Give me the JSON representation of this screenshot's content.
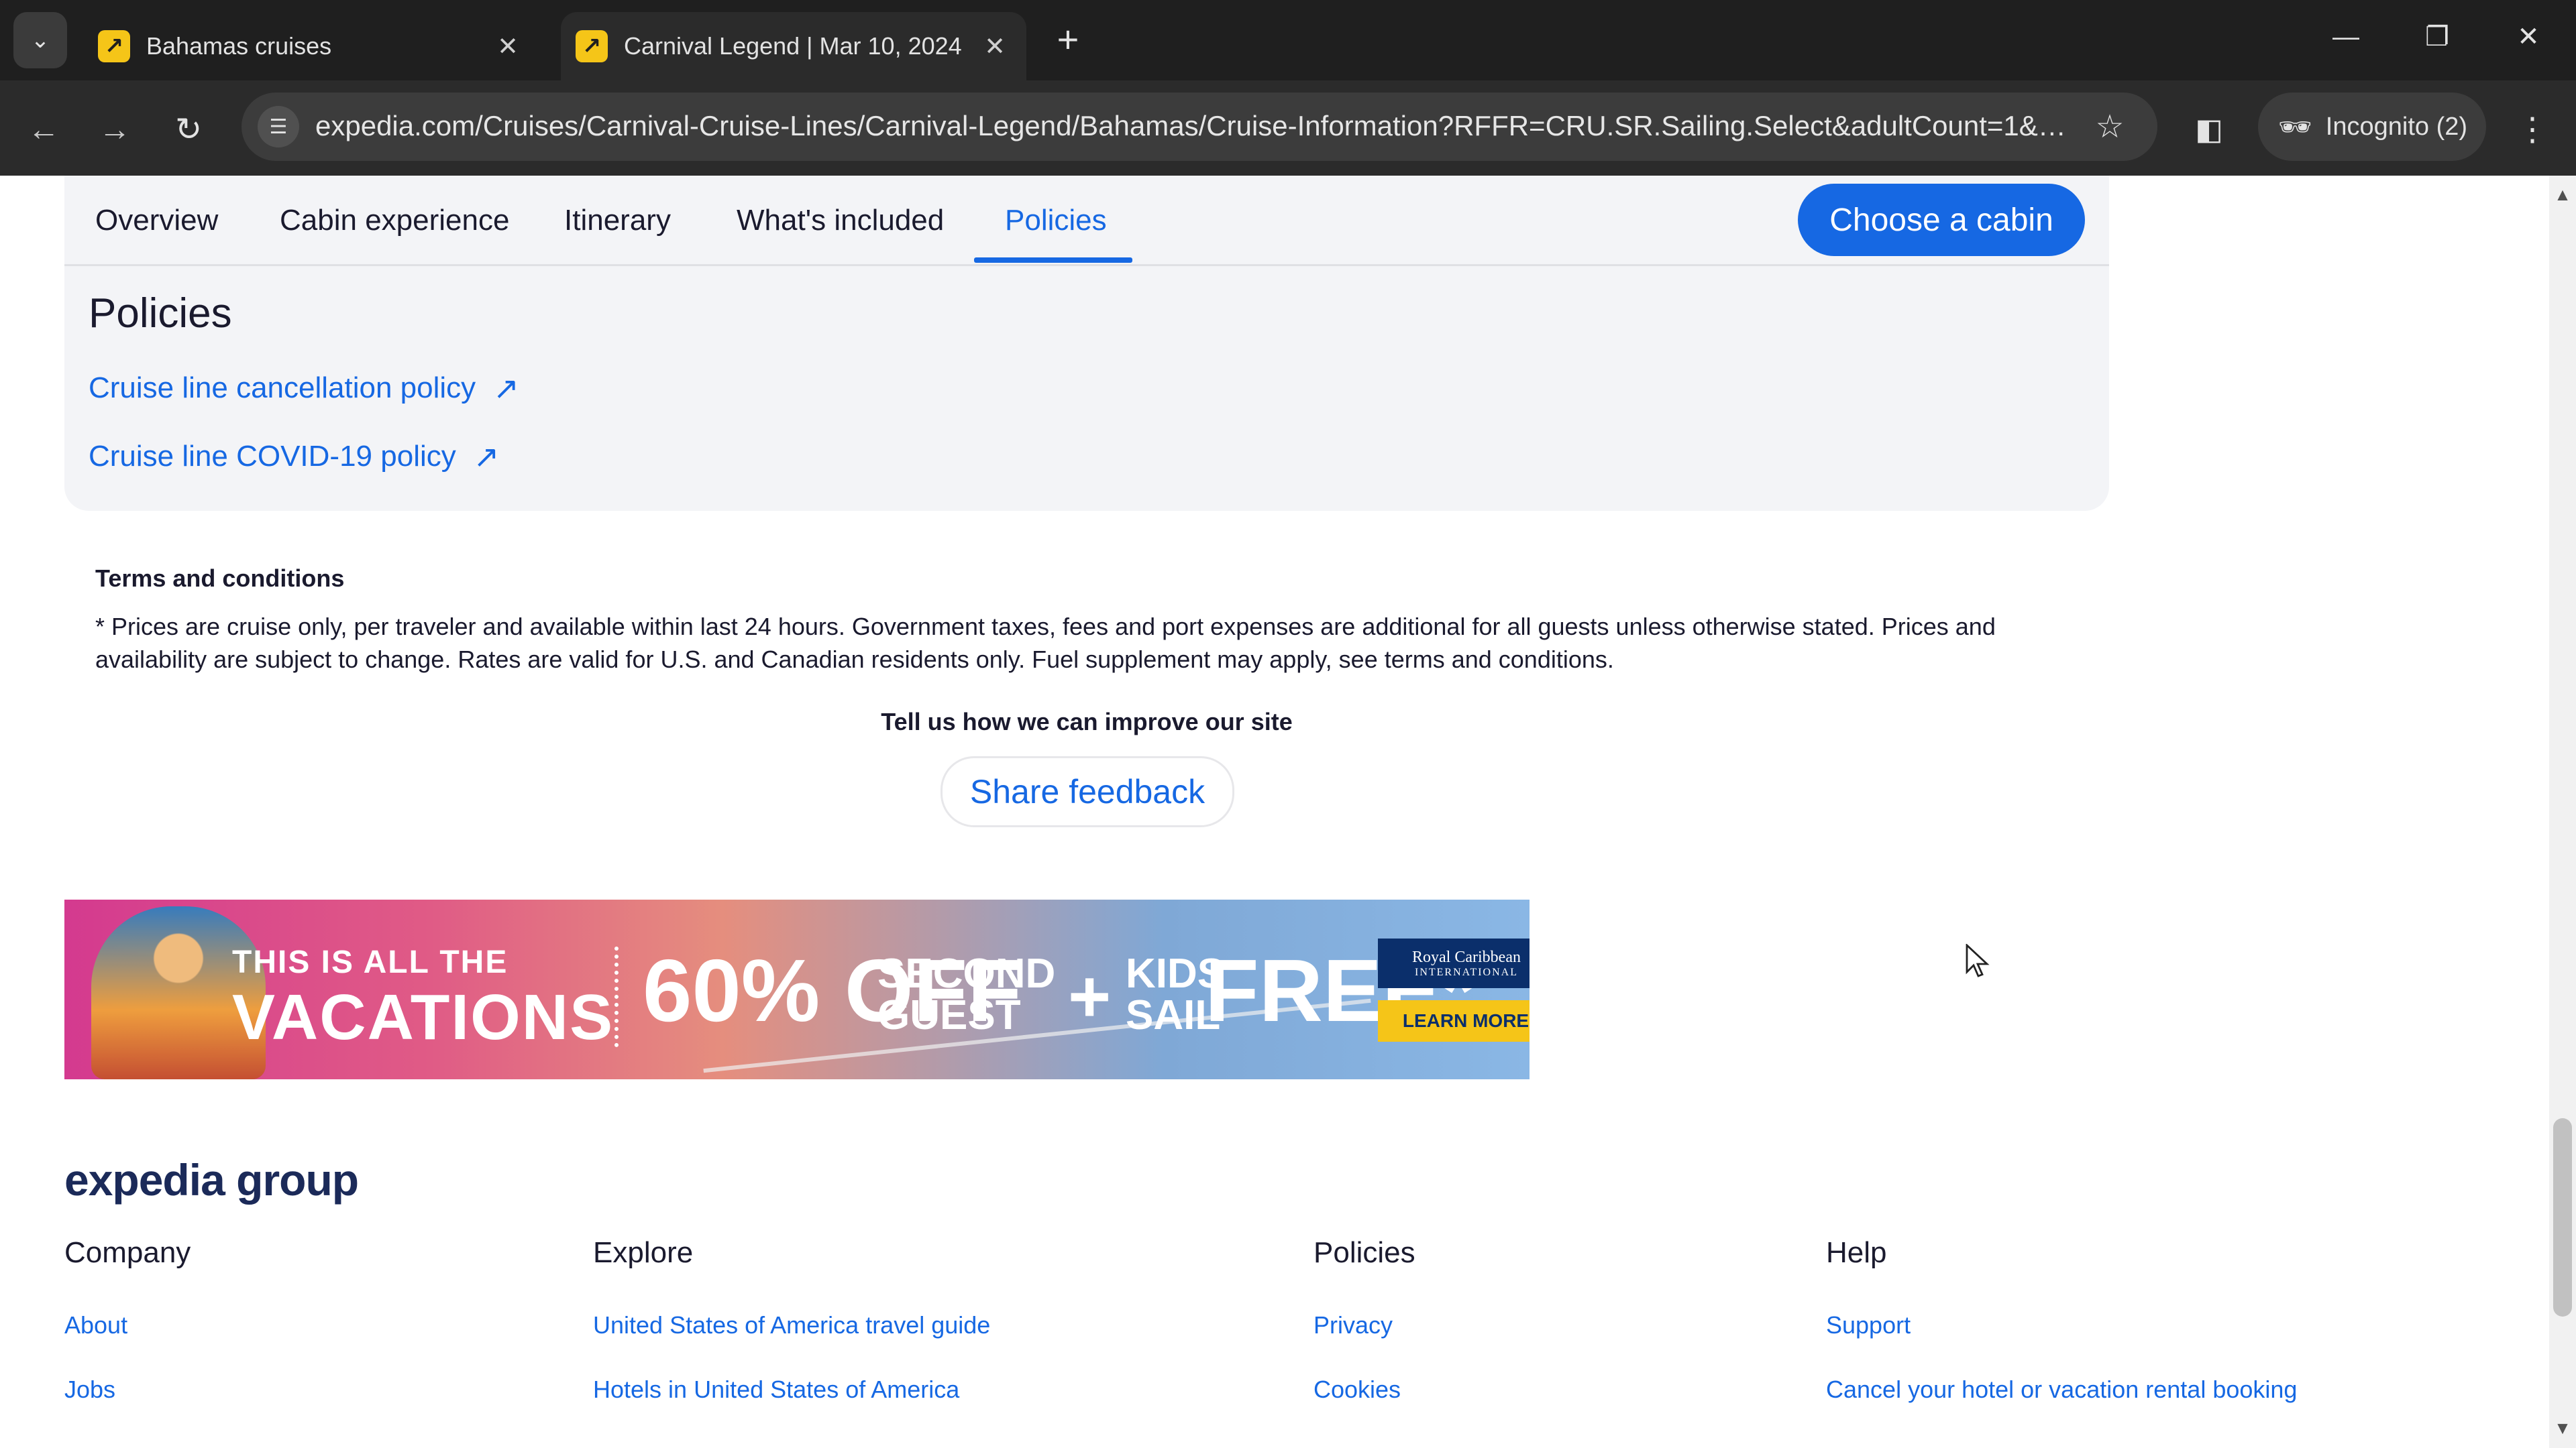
{
  "browser": {
    "tabs": [
      {
        "title": "Bahamas cruises",
        "active": false
      },
      {
        "title": "Carnival Legend | Mar 10, 2024",
        "active": true
      }
    ],
    "url": "expedia.com/Cruises/Carnival-Cruise-Lines/Carnival-Legend/Bahamas/Cruise-Information?RFFR=CRU.SR.Sailing.Select&adultCount=1&child...",
    "profile_label": "Incognito (2)",
    "icons": {
      "tab_list": "chevron-down-icon",
      "favicon": "expedia-favicon",
      "close": "close-icon",
      "new_tab": "plus-icon",
      "back": "back-arrow-icon",
      "forward": "forward-arrow-icon",
      "reload": "reload-icon",
      "site_info": "tune-icon",
      "bookmark": "star-icon",
      "side_panel": "side-panel-icon",
      "incognito": "incognito-icon",
      "menu": "kebab-menu-icon"
    }
  },
  "subnav": {
    "tabs": [
      "Overview",
      "Cabin experience",
      "Itinerary",
      "What's included",
      "Policies"
    ],
    "active_tab": "Policies",
    "cta_label": "Choose a cabin"
  },
  "policies": {
    "title": "Policies",
    "links": [
      "Cruise line cancellation policy",
      "Cruise line COVID-19 policy"
    ]
  },
  "terms": {
    "heading": "Terms and conditions",
    "body": "* Prices are cruise only, per traveler and available within last 24 hours. Government taxes, fees and port expenses are additional for all guests unless otherwise stated. Prices and availability are subject to change. Rates are valid for U.S. and Canadian residents only. Fuel supplement may apply, see terms and conditions."
  },
  "feedback": {
    "prompt": "Tell us how we can improve our site",
    "button_label": "Share feedback"
  },
  "ad": {
    "line1": "THIS IS ALL THE",
    "line2": "VACATIONS",
    "discount": "60% OFF",
    "second_guest": "SECOND GUEST",
    "plus": "+",
    "kids_sail": "KIDS SAIL",
    "free": "FREE*",
    "brand": "Royal Caribbean",
    "brand_sub": "INTERNATIONAL",
    "cta": "LEARN MORE"
  },
  "footer": {
    "logo": "expedia group",
    "columns": [
      {
        "title": "Company",
        "links": [
          "About",
          "Jobs"
        ]
      },
      {
        "title": "Explore",
        "links": [
          "United States of America travel guide",
          "Hotels in United States of America"
        ]
      },
      {
        "title": "Policies",
        "links": [
          "Privacy",
          "Cookies"
        ]
      },
      {
        "title": "Help",
        "links": [
          "Support",
          "Cancel your hotel or vacation rental booking"
        ]
      }
    ]
  },
  "colors": {
    "accent": "#1668e3",
    "text": "#1a1a2e",
    "card_bg": "#f3f4f7",
    "chrome_bg": "#1f1f1f",
    "ad_cta": "#f5c518"
  }
}
